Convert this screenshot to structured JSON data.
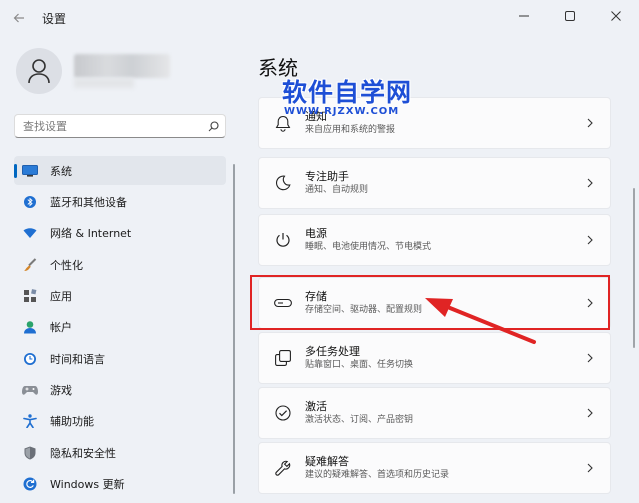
{
  "window": {
    "title": "设置"
  },
  "search": {
    "placeholder": "查找设置"
  },
  "sidebar": {
    "items": [
      {
        "label": "系统",
        "icon": "monitor-icon",
        "selected": true
      },
      {
        "label": "蓝牙和其他设备",
        "icon": "bluetooth-icon"
      },
      {
        "label": "网络 & Internet",
        "icon": "wifi-icon"
      },
      {
        "label": "个性化",
        "icon": "brush-icon"
      },
      {
        "label": "应用",
        "icon": "apps-icon"
      },
      {
        "label": "帐户",
        "icon": "person-icon"
      },
      {
        "label": "时间和语言",
        "icon": "clock-globe-icon"
      },
      {
        "label": "游戏",
        "icon": "gamepad-icon"
      },
      {
        "label": "辅助功能",
        "icon": "accessibility-icon"
      },
      {
        "label": "隐私和安全性",
        "icon": "shield-icon"
      },
      {
        "label": "Windows 更新",
        "icon": "update-icon"
      }
    ]
  },
  "main": {
    "title": "系统",
    "watermark": {
      "main": "软件自学网",
      "sub": "WWW.RJZXW.COM"
    },
    "cards": [
      {
        "title": "通知",
        "desc": "来自应用和系统的警报",
        "icon": "bell-icon"
      },
      {
        "title": "专注助手",
        "desc": "通知、自动规则",
        "icon": "moon-icon"
      },
      {
        "title": "电源",
        "desc": "睡眠、电池使用情况、节电模式",
        "icon": "power-icon"
      },
      {
        "title": "存储",
        "desc": "存储空间、驱动器、配置规则",
        "icon": "storage-drive-icon",
        "highlighted": true
      },
      {
        "title": "多任务处理",
        "desc": "贴靠窗口、桌面、任务切换",
        "icon": "multitask-icon"
      },
      {
        "title": "激活",
        "desc": "激活状态、订阅、产品密钥",
        "icon": "check-circle-icon"
      },
      {
        "title": "疑难解答",
        "desc": "建议的疑难解答、首选项和历史记录",
        "icon": "wrench-icon"
      }
    ]
  },
  "colors": {
    "accent": "#0067c0",
    "highlight": "#e02424",
    "watermark": "#1e4fd6"
  }
}
